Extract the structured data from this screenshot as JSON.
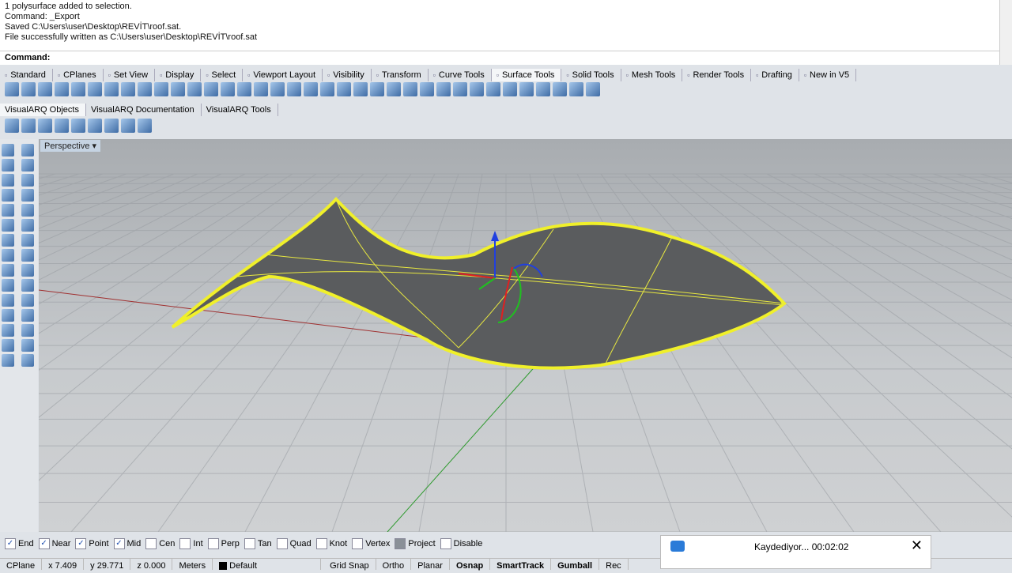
{
  "command_history": [
    "1 polysurface added to selection.",
    "Command: _Export",
    "Saved C:\\Users\\user\\Desktop\\REVİT\\roof.sat.",
    "File successfully written as C:\\Users\\user\\Desktop\\REVİT\\roof.sat"
  ],
  "command_prompt": "Command:",
  "toolbar_tabs": [
    "Standard",
    "CPlanes",
    "Set View",
    "Display",
    "Select",
    "Viewport Layout",
    "Visibility",
    "Transform",
    "Curve Tools",
    "Surface Tools",
    "Solid Tools",
    "Mesh Tools",
    "Render Tools",
    "Drafting",
    "New in V5"
  ],
  "active_toolbar_tab": "Surface Tools",
  "plugin_tabs": [
    "VisualARQ Objects",
    "VisualARQ Documentation",
    "VisualARQ Tools"
  ],
  "viewport": {
    "label": "Perspective"
  },
  "osnaps": [
    {
      "label": "End",
      "checked": true
    },
    {
      "label": "Near",
      "checked": true
    },
    {
      "label": "Point",
      "checked": true
    },
    {
      "label": "Mid",
      "checked": true
    },
    {
      "label": "Cen",
      "checked": false
    },
    {
      "label": "Int",
      "checked": false
    },
    {
      "label": "Perp",
      "checked": false
    },
    {
      "label": "Tan",
      "checked": false
    },
    {
      "label": "Quad",
      "checked": false
    },
    {
      "label": "Knot",
      "checked": false
    },
    {
      "label": "Vertex",
      "checked": false
    },
    {
      "label": "Project",
      "checked": true
    },
    {
      "label": "Disable",
      "checked": false
    }
  ],
  "status": {
    "cplane": "CPlane",
    "x": "x 7.409",
    "y": "y 29.771",
    "z": "z 0.000",
    "units": "Meters",
    "layer": "Default",
    "buttons": [
      "Grid Snap",
      "Ortho",
      "Planar",
      "Osnap",
      "SmartTrack",
      "Gumball",
      "Rec"
    ]
  },
  "recording": {
    "text": "Kaydediyor... 00:02:02"
  }
}
